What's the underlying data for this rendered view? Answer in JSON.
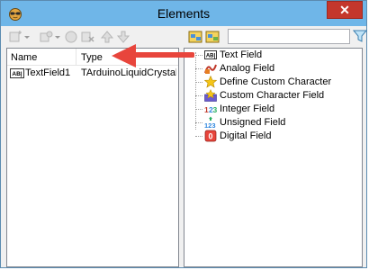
{
  "window": {
    "title": "Elements"
  },
  "title_bar": {
    "close_glyph": "✕"
  },
  "left_panel": {
    "columns": {
      "name": "Name",
      "type": "Type"
    },
    "rows": [
      {
        "name": "TextField1",
        "type": "TArduinoLiquidCrystal..."
      }
    ]
  },
  "right_panel": {
    "items": [
      {
        "label": "Text Field",
        "icon": "text-field-icon"
      },
      {
        "label": "Analog Field",
        "icon": "analog-field-icon"
      },
      {
        "label": "Define Custom Character",
        "icon": "star-icon"
      },
      {
        "label": "Custom Character Field",
        "icon": "star-field-icon"
      },
      {
        "label": "Integer Field",
        "icon": "integer-field-icon"
      },
      {
        "label": "Unsigned Field",
        "icon": "unsigned-field-icon"
      },
      {
        "label": "Digital Field",
        "icon": "digital-field-icon"
      }
    ]
  },
  "colors": {
    "title_bar": "#6fb6e8",
    "close_button": "#c4372c",
    "arrow": "#e8453c"
  }
}
